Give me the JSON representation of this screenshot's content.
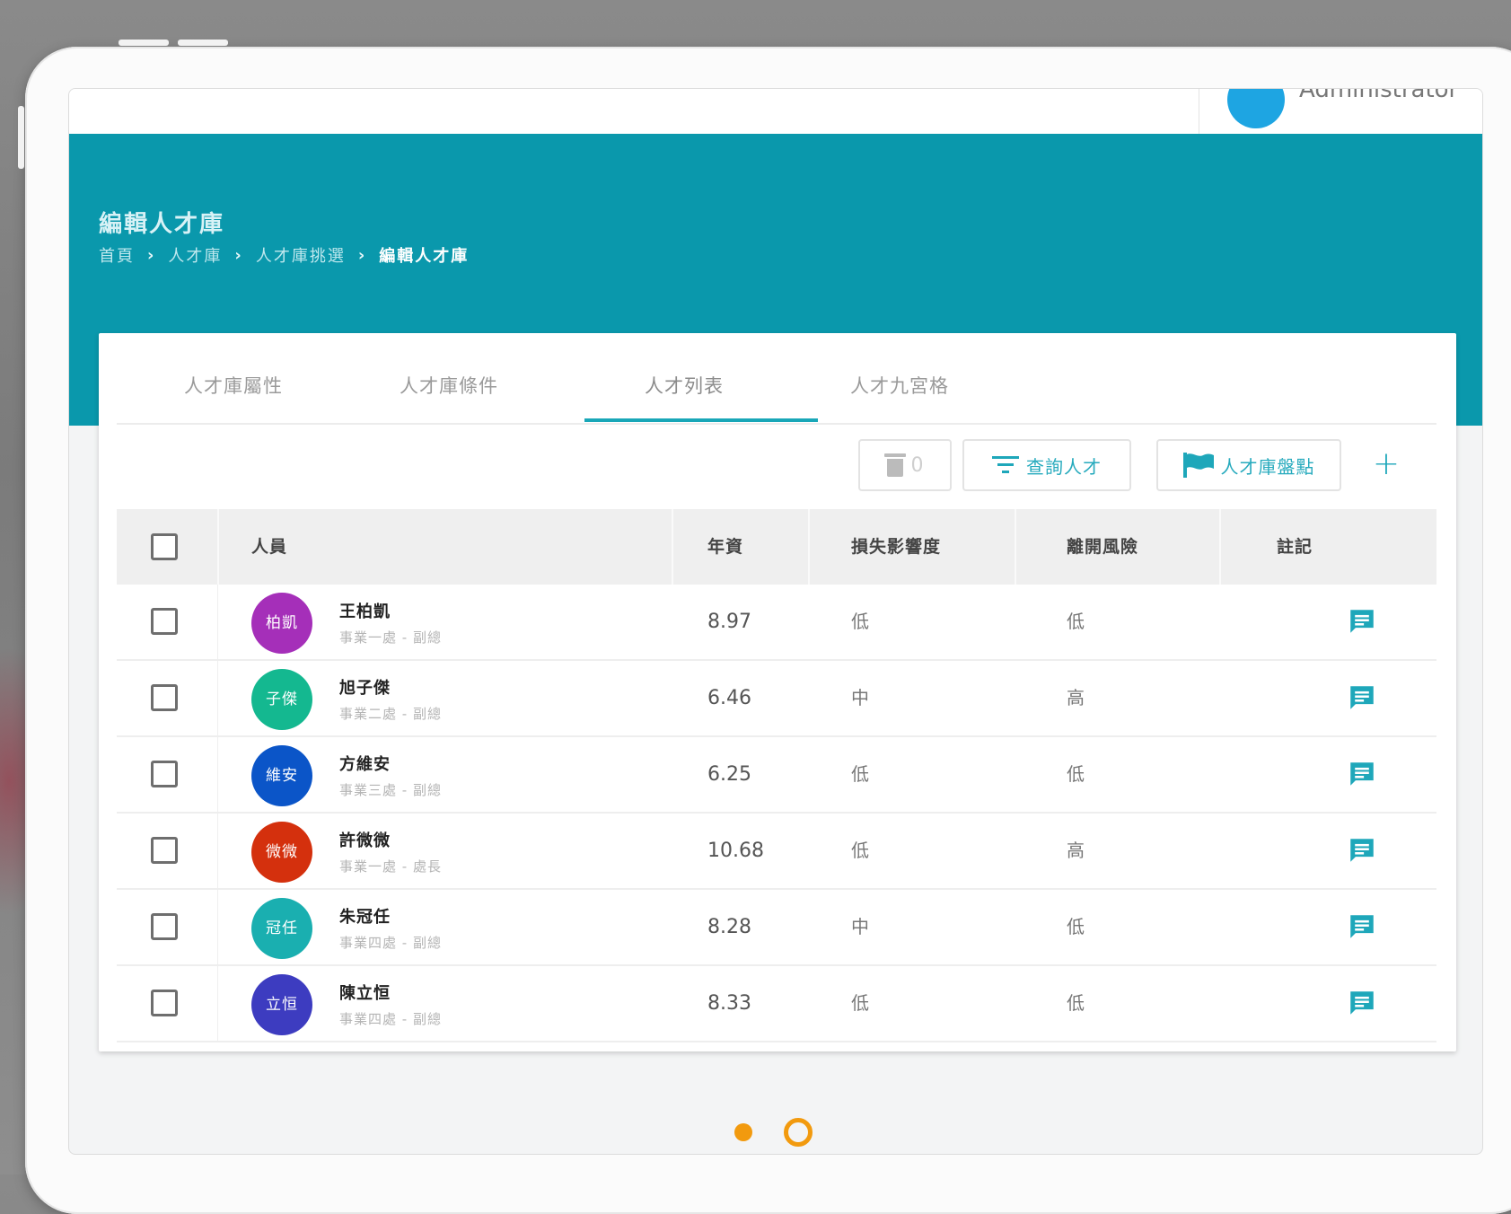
{
  "topbar": {
    "user_name": "Administrator"
  },
  "header": {
    "title": "編輯人才庫",
    "breadcrumb": [
      "首頁",
      "人才庫",
      "人才庫挑選",
      "編輯人才庫"
    ]
  },
  "tabs": [
    {
      "label": "人才庫屬性"
    },
    {
      "label": "人才庫條件"
    },
    {
      "label": "人才列表"
    },
    {
      "label": "人才九宮格"
    }
  ],
  "active_tab": "人才列表",
  "toolbar": {
    "trash_count": "0",
    "search_label": "查詢人才",
    "inventory_label": "人才庫盤點",
    "add_label": "+"
  },
  "table": {
    "columns": [
      "人員",
      "年資",
      "損失影響度",
      "離開風險",
      "註記"
    ],
    "rows": [
      {
        "avatar_text": "柏凱",
        "avatar_color": "#a52fb9",
        "name": "王柏凱",
        "dept": "事業一處 - 副總",
        "seniority": "8.97",
        "impact": "低",
        "risk": "低"
      },
      {
        "avatar_text": "子傑",
        "avatar_color": "#14b890",
        "name": "旭子傑",
        "dept": "事業二處 - 副總",
        "seniority": "6.46",
        "impact": "中",
        "risk": "高"
      },
      {
        "avatar_text": "維安",
        "avatar_color": "#0b55c8",
        "name": "方維安",
        "dept": "事業三處 - 副總",
        "seniority": "6.25",
        "impact": "低",
        "risk": "低"
      },
      {
        "avatar_text": "微微",
        "avatar_color": "#d4300d",
        "name": "許微微",
        "dept": "事業一處 - 處長",
        "seniority": "10.68",
        "impact": "低",
        "risk": "高"
      },
      {
        "avatar_text": "冠任",
        "avatar_color": "#1aafb0",
        "name": "朱冠任",
        "dept": "事業四處 - 副總",
        "seniority": "8.28",
        "impact": "中",
        "risk": "低"
      },
      {
        "avatar_text": "立恒",
        "avatar_color": "#3d3cc0",
        "name": "陳立恒",
        "dept": "事業四處 - 副總",
        "seniority": "8.33",
        "impact": "低",
        "risk": "低"
      }
    ]
  },
  "colors": {
    "accent": "#0a98ac",
    "icon": "#1ea7ba",
    "pager": "#f29a0e"
  },
  "pager": {
    "pages": 2,
    "current": 1
  }
}
